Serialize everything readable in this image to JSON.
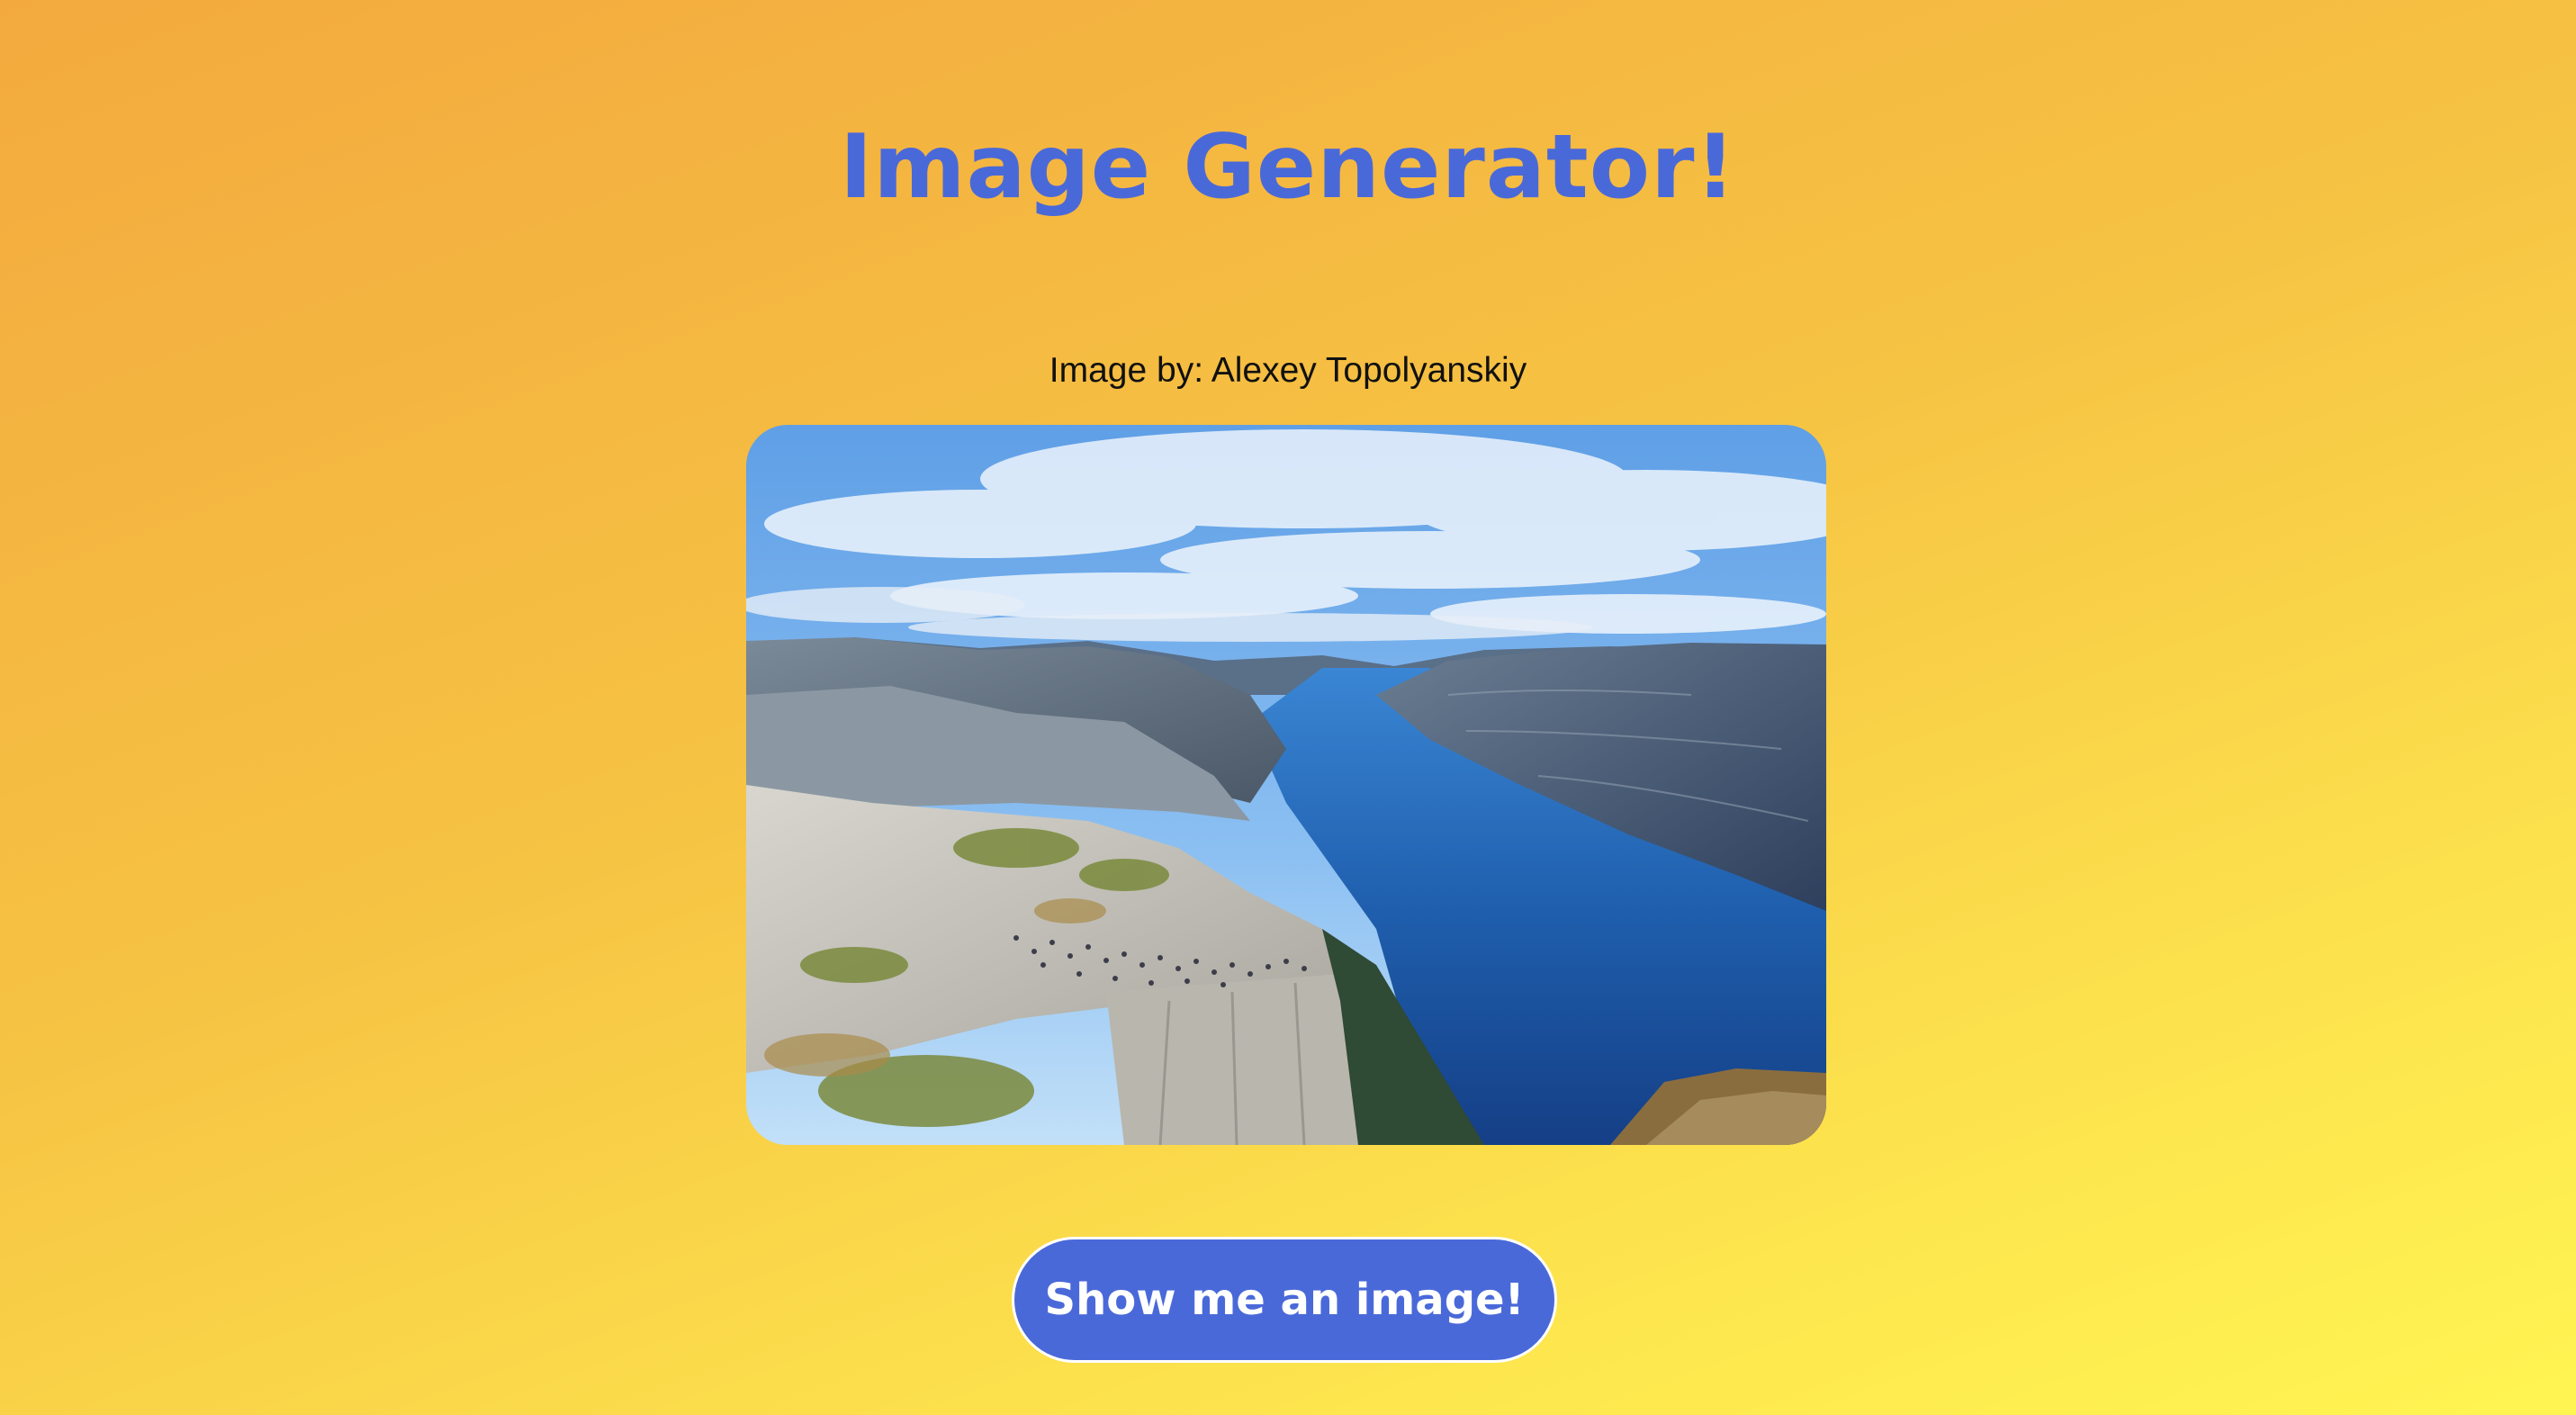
{
  "header": {
    "title": "Image Generator!"
  },
  "image": {
    "credit": "Image by: Alexey Topolyanskiy",
    "subject": "fjord-cliff-landscape"
  },
  "actions": {
    "show_image_label": "Show me an image!"
  },
  "colors": {
    "accent": "#4a69d9",
    "background_start": "#f3a93e",
    "background_end": "#fff552",
    "button_text": "#ffffff"
  }
}
